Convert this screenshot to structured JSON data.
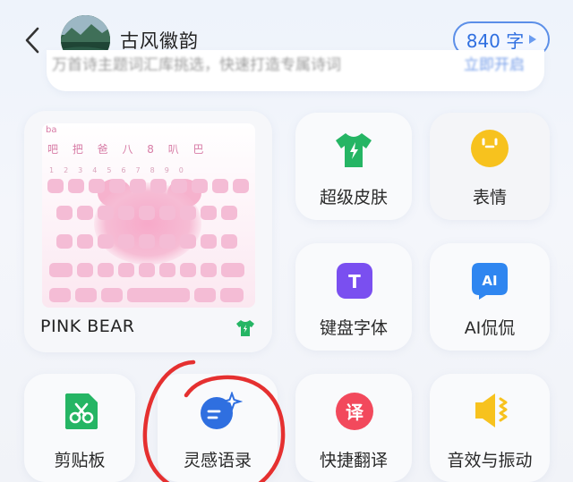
{
  "header": {
    "title": "古风徽韵",
    "char_count": "840 字"
  },
  "banner": {
    "obscured_text": "万首诗主题词汇库挑选，快速打造专属诗词",
    "obscured_link": "立即开启"
  },
  "skin": {
    "name": "PINK BEAR",
    "keyboard_prefix": "ba",
    "candidates": "吧 把 爸 八 8 叭 巴"
  },
  "features": {
    "super_skin": "超级皮肤",
    "emoji": "表情",
    "keyboard_font": "键盘字体",
    "ai_chat": "AI侃侃",
    "ai_badge": "AI",
    "font_badge": "T",
    "clipboard": "剪贴板",
    "inspiration": "灵感语录",
    "quick_translate": "快捷翻译",
    "translate_badge": "译",
    "sound_vibration": "音效与振动"
  },
  "colors": {
    "accent_blue": "#2f6fe0",
    "green": "#25b564",
    "yellow": "#f7c21e",
    "purple": "#7a4ff0",
    "red": "#f2495c",
    "annotation_circle": "#e53030"
  }
}
